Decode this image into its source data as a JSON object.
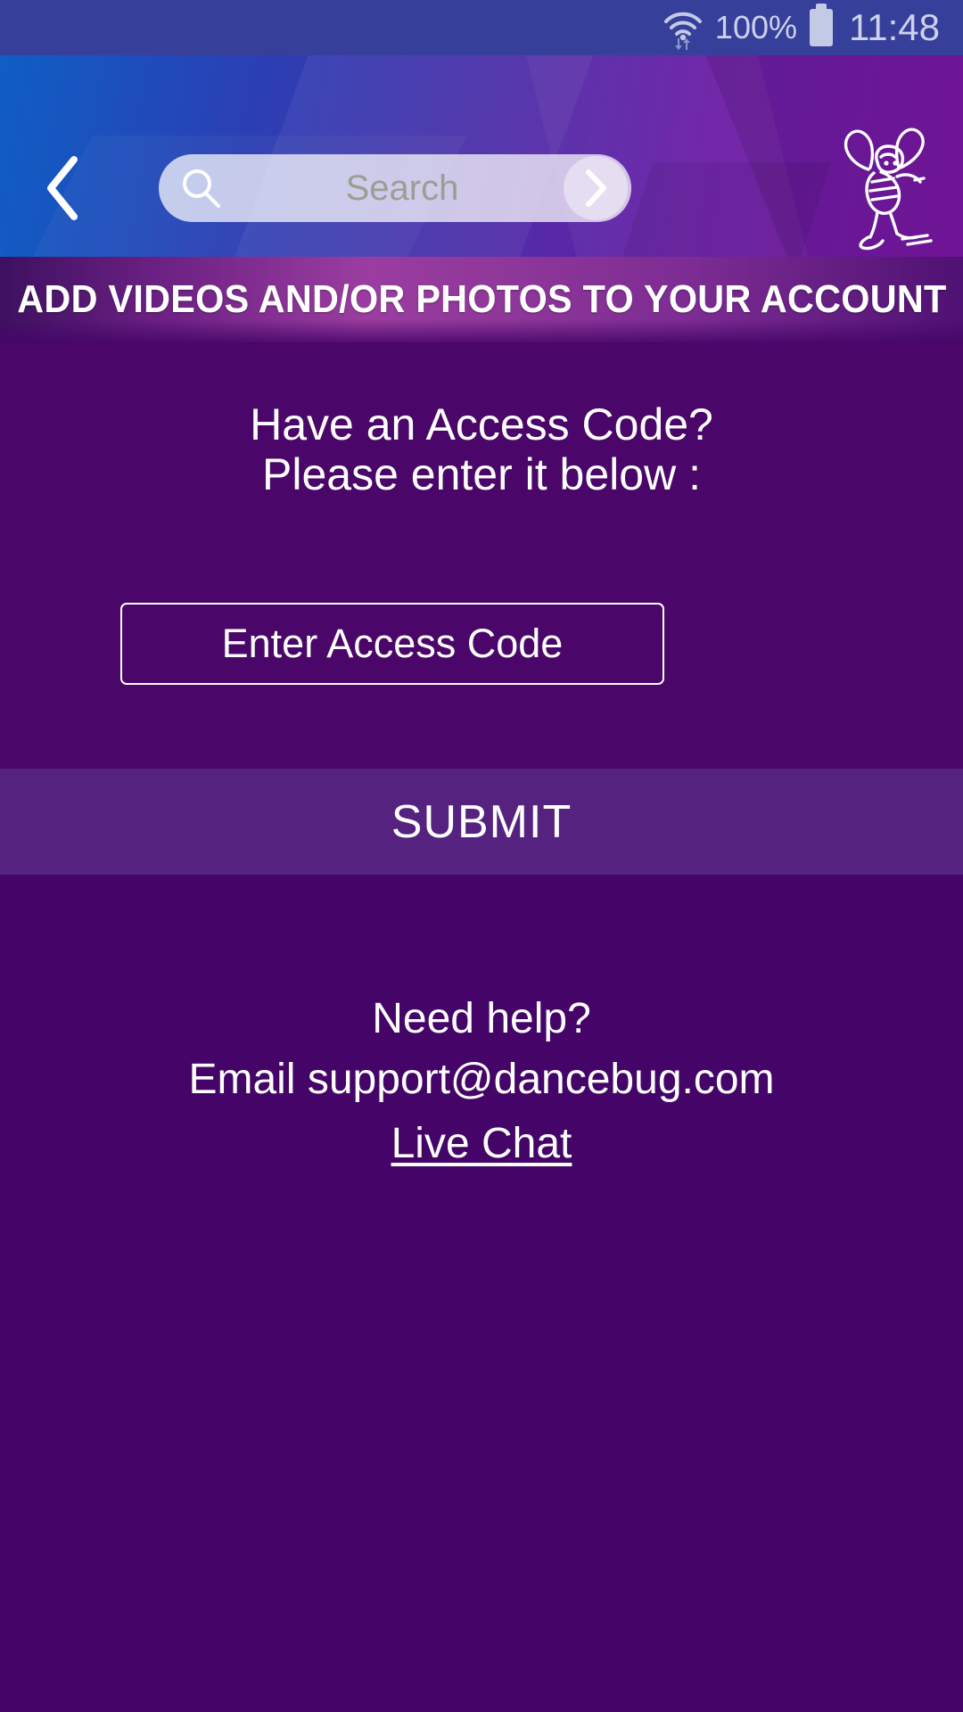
{
  "status_bar": {
    "wifi_icon": "wifi-with-transfer-arrows-icon",
    "battery_percent": "100%",
    "battery_icon": "battery-full-icon",
    "time": "11:48",
    "background_color": "#363f9a",
    "text_color": "#ccd2ea"
  },
  "header": {
    "back_icon": "chevron-left-icon",
    "search": {
      "icon": "search-icon",
      "placeholder": "Search",
      "value": "",
      "go_icon": "chevron-right-icon"
    },
    "logo_name": "dancebug-bee-logo",
    "gradient_from": "#0f5ec4",
    "gradient_to": "#7d17a8"
  },
  "banner": {
    "title": "ADD VIDEOS AND/OR PHOTOS TO YOUR ACCOUNT"
  },
  "access_code": {
    "prompt_line_1": "Have an Access Code?",
    "prompt_line_2": "Please enter it below :",
    "input_placeholder": "Enter Access Code",
    "input_value": "",
    "section_background": "#4a0668"
  },
  "submit": {
    "label": "SUBMIT",
    "background_color": "#552280"
  },
  "help": {
    "heading": "Need help?",
    "email_line": "Email support@dancebug.com",
    "live_chat_label": "Live Chat",
    "background_color": "#450568"
  }
}
